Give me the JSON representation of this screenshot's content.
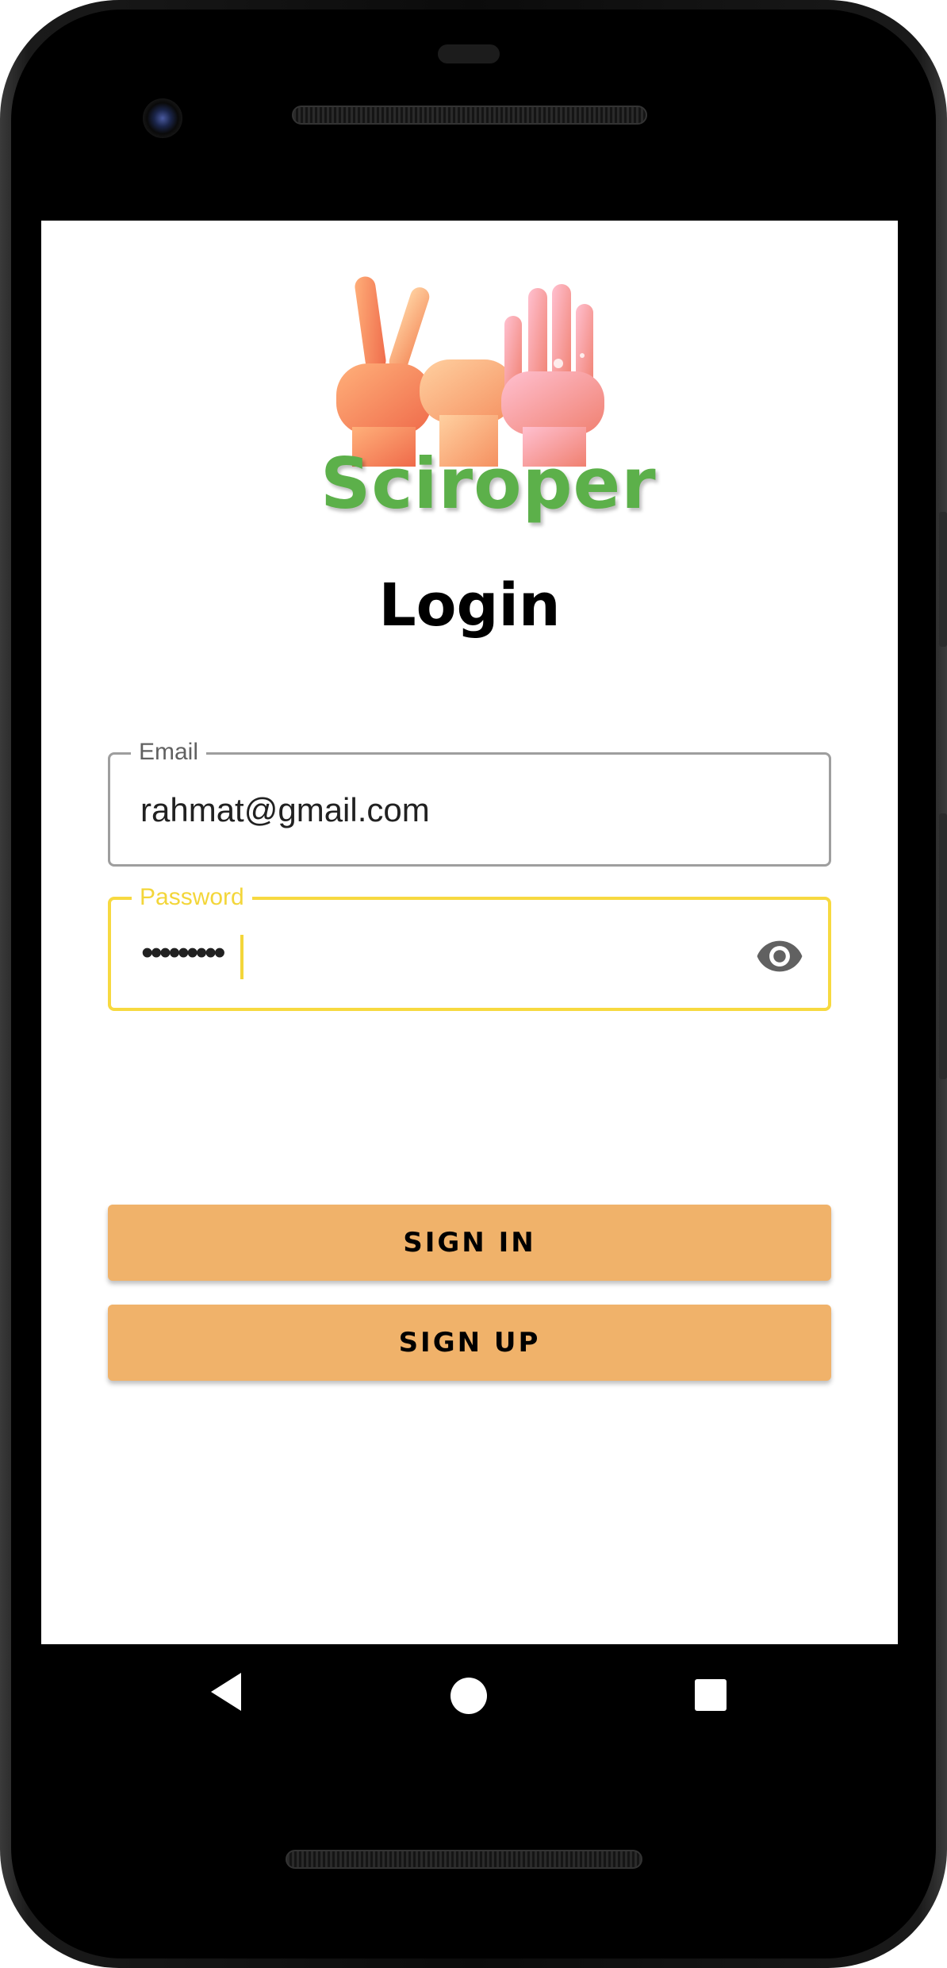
{
  "app": {
    "logo_text": "Sciroper",
    "title": "Login"
  },
  "form": {
    "email": {
      "label": "Email",
      "value": "rahmat@gmail.com"
    },
    "password": {
      "label": "Password",
      "masked_value": "•••••••••",
      "toggle_icon": "eye-icon"
    }
  },
  "buttons": {
    "sign_in": "SIGN IN",
    "sign_up": "SIGN UP"
  },
  "navigation": {
    "back_icon": "back-triangle-icon",
    "home_icon": "home-circle-icon",
    "recents_icon": "recents-square-icon"
  },
  "colors": {
    "accent_focus": "#f3d63a",
    "button_bg": "#f0b26a",
    "logo_green": "#5cb04a"
  }
}
